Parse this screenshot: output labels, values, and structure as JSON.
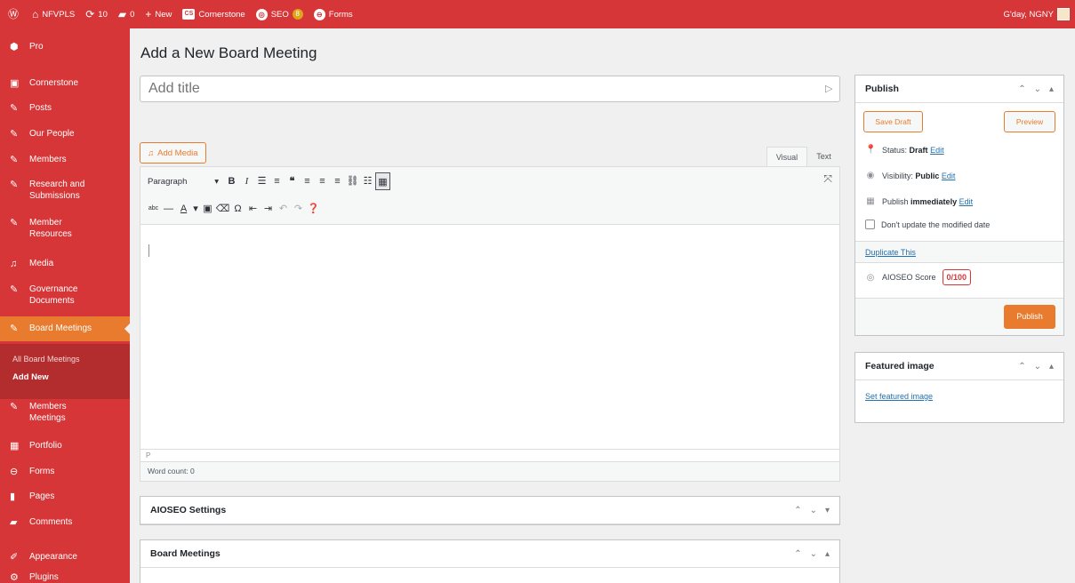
{
  "adminbar": {
    "site_name": "NFVPLS",
    "updates_count": "10",
    "comments_count": "0",
    "new_label": "New",
    "cornerstone_label": "Cornerstone",
    "seo_label": "SEO",
    "seo_badge": "8",
    "forms_label": "Forms",
    "greeting": "G'day, NGNY"
  },
  "sidebar": {
    "items": [
      {
        "label": "Pro",
        "icon": "pro-icon"
      },
      {
        "label": "Cornerstone",
        "icon": "cornerstone-icon"
      },
      {
        "label": "Posts",
        "icon": "pin-icon"
      },
      {
        "label": "Our People",
        "icon": "pin-icon"
      },
      {
        "label": "Members",
        "icon": "pin-icon"
      },
      {
        "label": "Research and",
        "label2": "Submissions",
        "icon": "pin-icon"
      },
      {
        "label": "Member",
        "label2": "Resources",
        "icon": "pin-icon"
      },
      {
        "label": "Media",
        "icon": "media-icon"
      },
      {
        "label": "Governance",
        "label2": "Documents",
        "icon": "pin-icon"
      },
      {
        "label": "Board Meetings",
        "icon": "pin-icon"
      },
      {
        "label": "Members",
        "label2": "Meetings",
        "icon": "pin-icon"
      },
      {
        "label": "Portfolio",
        "icon": "portfolio-icon"
      },
      {
        "label": "Forms",
        "icon": "forms-icon"
      },
      {
        "label": "Pages",
        "icon": "pages-icon"
      },
      {
        "label": "Comments",
        "icon": "comments-icon"
      },
      {
        "label": "Appearance",
        "icon": "appearance-icon"
      },
      {
        "label": "Plugins",
        "icon": "plugins-icon"
      }
    ],
    "submenu": {
      "all": "All Board Meetings",
      "add_new": "Add New"
    }
  },
  "main": {
    "page_title": "Add a New Board Meeting",
    "title_placeholder": "Add title",
    "add_media_label": "Add Media",
    "tab_visual": "Visual",
    "tab_text": "Text",
    "format_select": "Paragraph",
    "path_label": "P",
    "word_count": "Word count: 0"
  },
  "publish": {
    "title": "Publish",
    "save_draft": "Save Draft",
    "preview": "Preview",
    "status_label": "Status:",
    "status_value": "Draft",
    "visibility_label": "Visibility:",
    "visibility_value": "Public",
    "publish_label": "Publish",
    "publish_value": "immediately",
    "edit": "Edit",
    "dont_update": "Don't update the modified date",
    "duplicate": "Duplicate This",
    "aioseo_label": "AIOSEO Score",
    "aioseo_score": "0/100",
    "publish_button": "Publish"
  },
  "featured": {
    "title": "Featured image",
    "set_link": "Set featured image"
  },
  "metaboxes": {
    "aioseo": "AIOSEO Settings",
    "board": "Board Meetings"
  },
  "colors": {
    "admin_bar": "#d63638",
    "accent": "#e87b2d",
    "submenu": "#b32d2e"
  }
}
